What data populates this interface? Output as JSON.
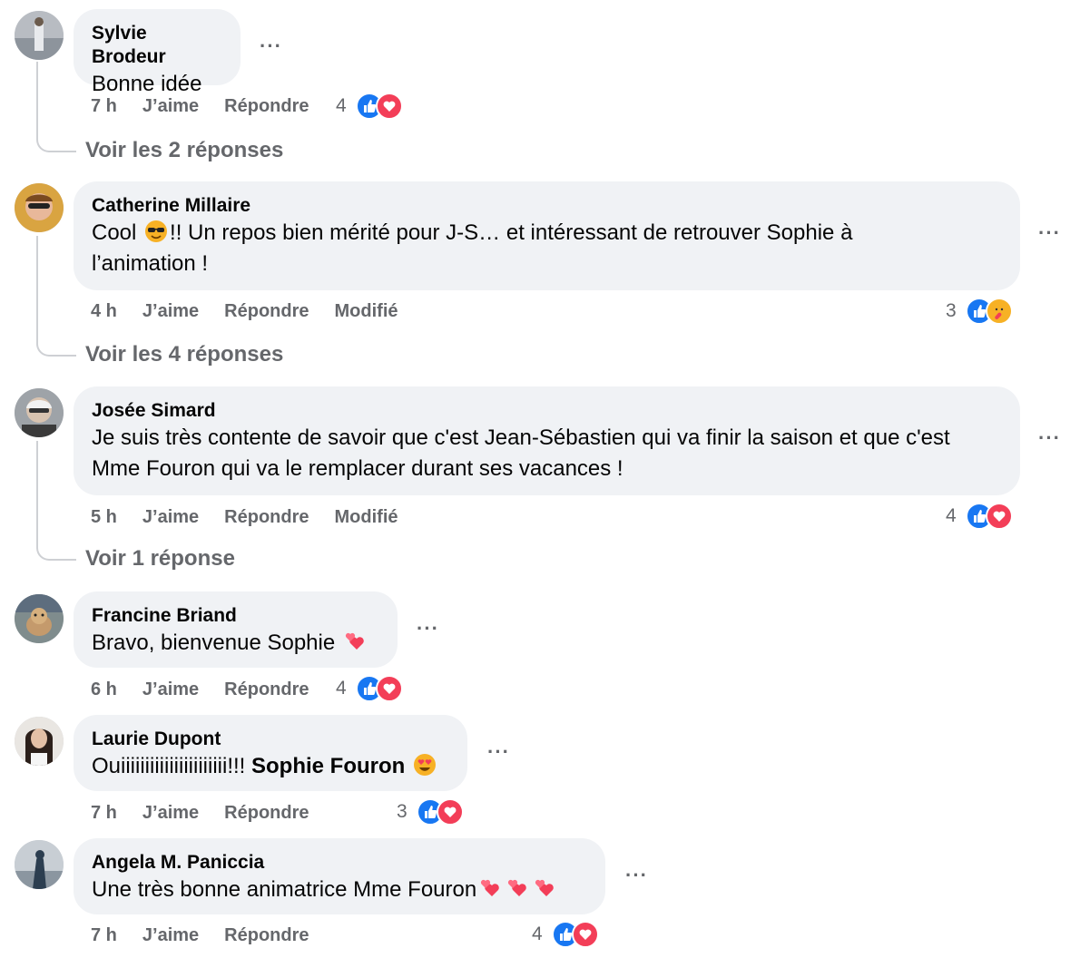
{
  "comments": [
    {
      "author": "Sylvie Brodeur",
      "text": "Bonne idée",
      "time": "7 h",
      "like": "J’aime",
      "reply": "Répondre",
      "reaction_count": "4",
      "reactions": [
        "like-icon",
        "love-icon"
      ],
      "replies_link": "Voir les 2 réponses"
    },
    {
      "author": "Catherine Millaire",
      "text_before_emoji": "Cool ",
      "emoji": "sunglasses-emoji",
      "text_after_emoji": "!! Un repos bien mérité pour J-S… et intéressant de retrouver Sophie à",
      "text_line2": "l’animation !",
      "time": "4 h",
      "like": "J’aime",
      "reply": "Répondre",
      "edited": "Modifié",
      "reaction_count": "3",
      "reactions": [
        "like-icon",
        "care-icon"
      ],
      "replies_link": "Voir les 4 réponses"
    },
    {
      "author": "Josée Simard",
      "text_line1": "Je suis très contente de savoir que c'est Jean-Sébastien qui va finir la saison et que c'est",
      "text_line2": "Mme Fouron qui va le remplacer durant ses vacances !",
      "time": "5 h",
      "like": "J’aime",
      "reply": "Répondre",
      "edited": "Modifié",
      "reaction_count": "4",
      "reactions": [
        "like-icon",
        "love-icon"
      ],
      "replies_link": "Voir 1 réponse"
    },
    {
      "author": "Francine Briand",
      "text": "Bravo, bienvenue Sophie",
      "emoji": "two-hearts-emoji",
      "time": "6 h",
      "like": "J’aime",
      "reply": "Répondre",
      "reaction_count": "4",
      "reactions": [
        "like-icon",
        "love-icon"
      ]
    },
    {
      "author": "Laurie Dupont",
      "text": "Ouiiiiiiiiiiiiiiiiiiiiii!!! ",
      "mention": "Sophie Fouron",
      "emoji": "heart-eyes-emoji",
      "time": "7 h",
      "like": "J’aime",
      "reply": "Répondre",
      "reaction_count": "3",
      "reactions": [
        "like-icon",
        "love-icon"
      ]
    },
    {
      "author": "Angela M. Paniccia",
      "text": "Une très bonne animatrice Mme Fouron",
      "emoji": "two-hearts-emoji",
      "time": "7 h",
      "like": "J’aime",
      "reply": "Répondre",
      "reaction_count": "4",
      "reactions": [
        "like-icon",
        "love-icon"
      ]
    }
  ],
  "more_label": "···",
  "colors": {
    "bubble": "#f0f2f5",
    "secondary_text": "#65676b",
    "like_blue": "#1877f2",
    "love_red": "#f33e58"
  }
}
